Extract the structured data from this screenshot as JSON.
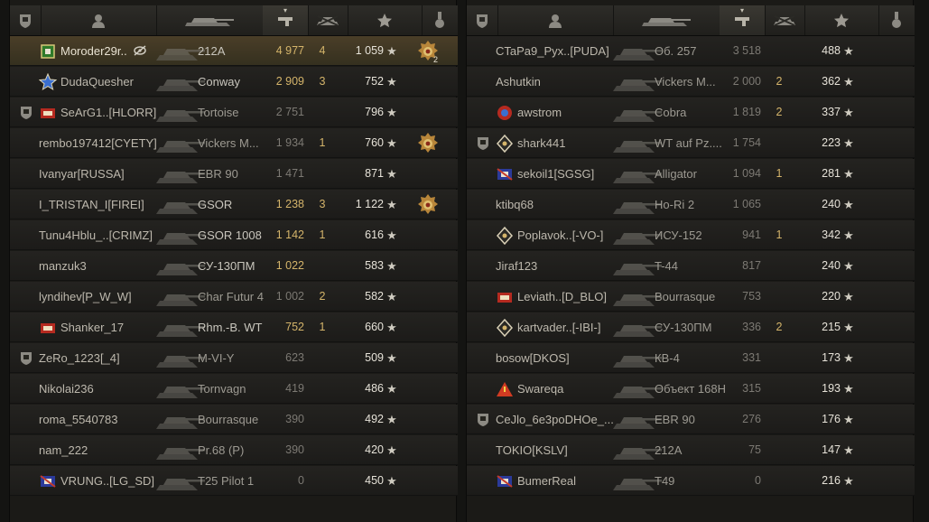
{
  "headers": {
    "platoon_icon": "shield-icon",
    "player_icon": "person-icon",
    "vehicle_icon": "tank-icon",
    "sort_indicator": "▾",
    "damage_icon": "gun-icon",
    "kills_icon": "destroyed-tank-icon",
    "xp_icon": "star-icon",
    "medal_icon": "medal-icon"
  },
  "left_team": [
    {
      "player": "Moroder29r..",
      "name_icon": "clan-emblem-green",
      "status_icon": "eye-slash-icon",
      "vehicle": "212A",
      "damage": "4 977",
      "kills": "4",
      "xp": "1 059",
      "medal": "mastery-medal",
      "medal_count": "2",
      "highlight": true
    },
    {
      "player": "DudaQuesher",
      "name_icon": "clan-emblem-star",
      "vehicle": "Conway",
      "damage": "2 909",
      "kills": "3",
      "xp": "752"
    },
    {
      "player": "SeArG1..[HLORR]",
      "badge": "platoon-shield-icon",
      "name_icon": "clan-emblem-red",
      "vehicle": "Tortoise",
      "damage": "2 751",
      "kills": "",
      "xp": "796",
      "dim": true
    },
    {
      "player": "rembo197412[CYETY]",
      "vehicle": "Vickers M...",
      "damage": "1 934",
      "kills": "1",
      "xp": "760",
      "medal": "mastery-medal",
      "dim": true
    },
    {
      "player": "Ivanyar[RUSSA]",
      "vehicle": "EBR 90",
      "damage": "1 471",
      "kills": "",
      "xp": "871",
      "dim": true
    },
    {
      "player": "I_TRISTAN_I[FIREI]",
      "vehicle": "GSOR",
      "damage": "1 238",
      "kills": "3",
      "xp": "1 122",
      "medal": "mastery-medal"
    },
    {
      "player": "Tunu4Hblu_..[CRIMZ]",
      "vehicle": "GSOR 1008",
      "damage": "1 142",
      "kills": "1",
      "xp": "616"
    },
    {
      "player": "manzuk3",
      "vehicle": "СУ-130ПМ",
      "damage": "1 022",
      "kills": "",
      "xp": "583"
    },
    {
      "player": "lyndihev[P_W_W]",
      "vehicle": "Char Futur 4",
      "damage": "1 002",
      "kills": "2",
      "xp": "582",
      "dim": true
    },
    {
      "player": "Shanker_17",
      "name_icon": "clan-emblem-red",
      "vehicle": "Rhm.-B. WT",
      "damage": "752",
      "kills": "1",
      "xp": "660"
    },
    {
      "player": "ZeRo_1223[_4]",
      "badge": "platoon-shield-icon",
      "vehicle": "M-VI-Y",
      "damage": "623",
      "kills": "",
      "xp": "509",
      "dim": true
    },
    {
      "player": "Nikolai236",
      "vehicle": "Tornvagn",
      "damage": "419",
      "kills": "",
      "xp": "486",
      "dim": true
    },
    {
      "player": "roma_5540783",
      "vehicle": "Bourrasque",
      "damage": "390",
      "kills": "",
      "xp": "492",
      "dim": true
    },
    {
      "player": "nam_222",
      "vehicle": "Pr.68 (P)",
      "damage": "390",
      "kills": "",
      "xp": "420",
      "dim": true
    },
    {
      "player": "VRUNG..[LG_SD]",
      "name_icon": "clan-emblem-flag",
      "vehicle": "T25 Pilot 1",
      "damage": "0",
      "kills": "",
      "xp": "450",
      "dim": true
    }
  ],
  "right_team": [
    {
      "player": "CTaPa9_Pyx..[PUDA]",
      "vehicle": "Об. 257",
      "damage": "3 518",
      "kills": "",
      "xp": "488",
      "dim": true
    },
    {
      "player": "Ashutkin",
      "vehicle": "Vickers M...",
      "damage": "2 000",
      "kills": "2",
      "xp": "362",
      "dim": true
    },
    {
      "player": "awstrom",
      "name_icon": "clan-emblem-red-circle",
      "vehicle": "Cobra",
      "damage": "1 819",
      "kills": "2",
      "xp": "337",
      "dim": true
    },
    {
      "player": "shark441",
      "badge": "platoon-shield-icon",
      "name_icon": "clan-emblem-diamond",
      "vehicle": "WT auf Pz....",
      "damage": "1 754",
      "kills": "",
      "xp": "223",
      "dim": true
    },
    {
      "player": "sekoil1[SGSG]",
      "name_icon": "clan-emblem-flag",
      "vehicle": "Alligator",
      "damage": "1 094",
      "kills": "1",
      "xp": "281",
      "dim": true
    },
    {
      "player": "ktibq68",
      "vehicle": "Ho-Ri 2",
      "damage": "1 065",
      "kills": "",
      "xp": "240",
      "dim": true
    },
    {
      "player": "Poplavok..[-VO-]",
      "name_icon": "clan-emblem-diamond",
      "vehicle": "ИСУ-152",
      "damage": "941",
      "kills": "1",
      "xp": "342",
      "dim": true
    },
    {
      "player": "Jiraf123",
      "vehicle": "T-44",
      "damage": "817",
      "kills": "",
      "xp": "240",
      "dim": true
    },
    {
      "player": "Leviath..[D_BLO]",
      "name_icon": "clan-emblem-red",
      "vehicle": "Bourrasque",
      "damage": "753",
      "kills": "",
      "xp": "220",
      "dim": true
    },
    {
      "player": "kartvader..[-IBI-]",
      "name_icon": "clan-emblem-diamond",
      "vehicle": "СУ-130ПМ",
      "damage": "336",
      "kills": "2",
      "xp": "215",
      "dim": true
    },
    {
      "player": "bosow[DKOS]",
      "vehicle": "КВ-4",
      "damage": "331",
      "kills": "",
      "xp": "173",
      "dim": true
    },
    {
      "player": "Swareqa",
      "name_icon": "clan-emblem-triangle",
      "vehicle": "Объект 168Н",
      "damage": "315",
      "kills": "",
      "xp": "193",
      "dim": true
    },
    {
      "player": "CeJlo_6e3poDHOe_...",
      "badge": "platoon-shield-icon",
      "vehicle": "EBR 90",
      "damage": "276",
      "kills": "",
      "xp": "176",
      "dim": true
    },
    {
      "player": "TOKIO[KSLV]",
      "vehicle": "212A",
      "damage": "75",
      "kills": "",
      "xp": "147",
      "dim": true
    },
    {
      "player": "BumerReal",
      "name_icon": "clan-emblem-flag",
      "vehicle": "T49",
      "damage": "0",
      "kills": "",
      "xp": "216",
      "dim": true
    }
  ],
  "colors": {
    "damage": "#d4b46a",
    "xp": "#e6e2d8",
    "highlight_row": "#4a3e28"
  }
}
